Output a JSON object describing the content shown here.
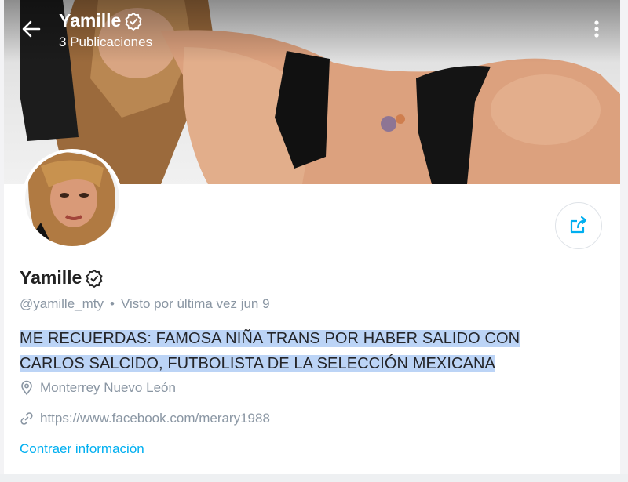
{
  "header": {
    "title": "Yamille",
    "subtitle": "3 Publicaciones",
    "back_icon": "arrow-left-icon",
    "more_icon": "more-vertical-icon"
  },
  "profile": {
    "name": "Yamille",
    "verified_icon": "verified-badge-icon",
    "handle": "@yamille_mty",
    "separator": "•",
    "last_seen": "Visto por última vez jun 9",
    "bio": "ME RECUERDAS: FAMOSA NIÑA TRANS POR HABER SALIDO CON CARLOS SALCIDO, FUTBOLISTA DE LA SELECCIÓN MEXICANA",
    "location": "Monterrey Nuevo León",
    "website": "https://www.facebook.com/merary1988",
    "collapse_label": "Contraer información"
  },
  "colors": {
    "accent": "#00aff0",
    "muted": "#8a96a3",
    "highlight": "#bcd4f6"
  }
}
